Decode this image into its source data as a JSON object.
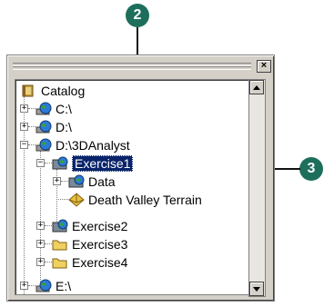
{
  "callouts": {
    "top": "2",
    "right": "3"
  },
  "window": {
    "close_label": "×"
  },
  "tree": {
    "items": [
      {
        "label": "Catalog"
      },
      {
        "label": "C:\\"
      },
      {
        "label": "D:\\"
      },
      {
        "label": "D:\\3DAnalyst"
      },
      {
        "label": "Exercise1"
      },
      {
        "label": "Data"
      },
      {
        "label": "Death Valley Terrain"
      },
      {
        "label": "Exercise2"
      },
      {
        "label": "Exercise3"
      },
      {
        "label": "Exercise4"
      },
      {
        "label": "E:\\"
      }
    ]
  },
  "colors": {
    "callout": "#1d6f5c",
    "selection": "#0a246a"
  }
}
